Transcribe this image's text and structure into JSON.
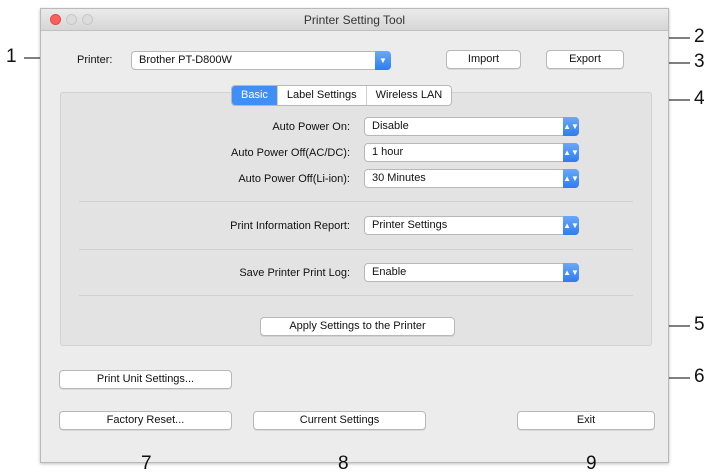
{
  "window": {
    "title": "Printer Setting Tool"
  },
  "printer": {
    "label": "Printer:",
    "value": "Brother PT-D800W"
  },
  "toolbar": {
    "import": "Import",
    "export": "Export"
  },
  "tabs": [
    {
      "label": "Basic",
      "selected": true
    },
    {
      "label": "Label Settings",
      "selected": false
    },
    {
      "label": "Wireless LAN",
      "selected": false
    }
  ],
  "settings": {
    "auto_power_on": {
      "label": "Auto Power On:",
      "value": "Disable"
    },
    "auto_power_off_ac": {
      "label": "Auto Power Off(AC/DC):",
      "value": "1 hour"
    },
    "auto_power_off_li": {
      "label": "Auto Power Off(Li-ion):",
      "value": "30 Minutes"
    },
    "print_info_report": {
      "label": "Print Information Report:",
      "value": "Printer Settings"
    },
    "save_print_log": {
      "label": "Save Printer Print Log:",
      "value": "Enable"
    }
  },
  "buttons": {
    "apply": "Apply Settings to the Printer",
    "print_unit": "Print Unit Settings...",
    "factory_reset": "Factory Reset...",
    "current_settings": "Current Settings",
    "exit": "Exit"
  },
  "callouts": [
    "1",
    "2",
    "3",
    "4",
    "5",
    "6",
    "7",
    "8",
    "9"
  ],
  "colors": {
    "accent": "#3f8ff7",
    "close": "#fc605c"
  }
}
